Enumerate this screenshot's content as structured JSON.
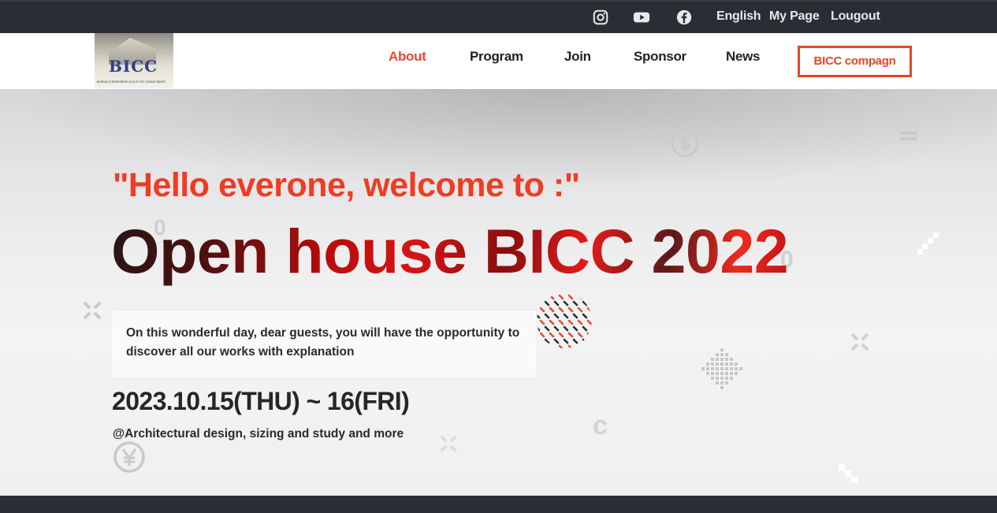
{
  "topbar": {
    "social": [
      "instagram-icon",
      "youtube-icon",
      "facebook-icon"
    ],
    "language": "English",
    "mypage": "My Page",
    "logout": "Lougout"
  },
  "logo": {
    "text": "BICC",
    "tagline": "BUREAU D'INGENIERIE CIVIL ET DE CONSULTANCE"
  },
  "nav": {
    "items": [
      {
        "label": "About",
        "active": true
      },
      {
        "label": "Program"
      },
      {
        "label": "Join"
      },
      {
        "label": "Sponsor"
      },
      {
        "label": "News"
      }
    ],
    "campaign": "BICC compagn"
  },
  "hero": {
    "greeting": "\"Hello everone, welcome to :\"",
    "headline": "Open house BICC 2022",
    "description": "On this wonderful day, dear guests, you will have the opportunity to discover all our works with explanation",
    "date": "2023.10.15(THU) ~ 16(FRI)",
    "subline": "@Architectural design, sizing and study and more"
  },
  "colors": {
    "accent": "#e8492f",
    "dark": "#2b2d35"
  }
}
